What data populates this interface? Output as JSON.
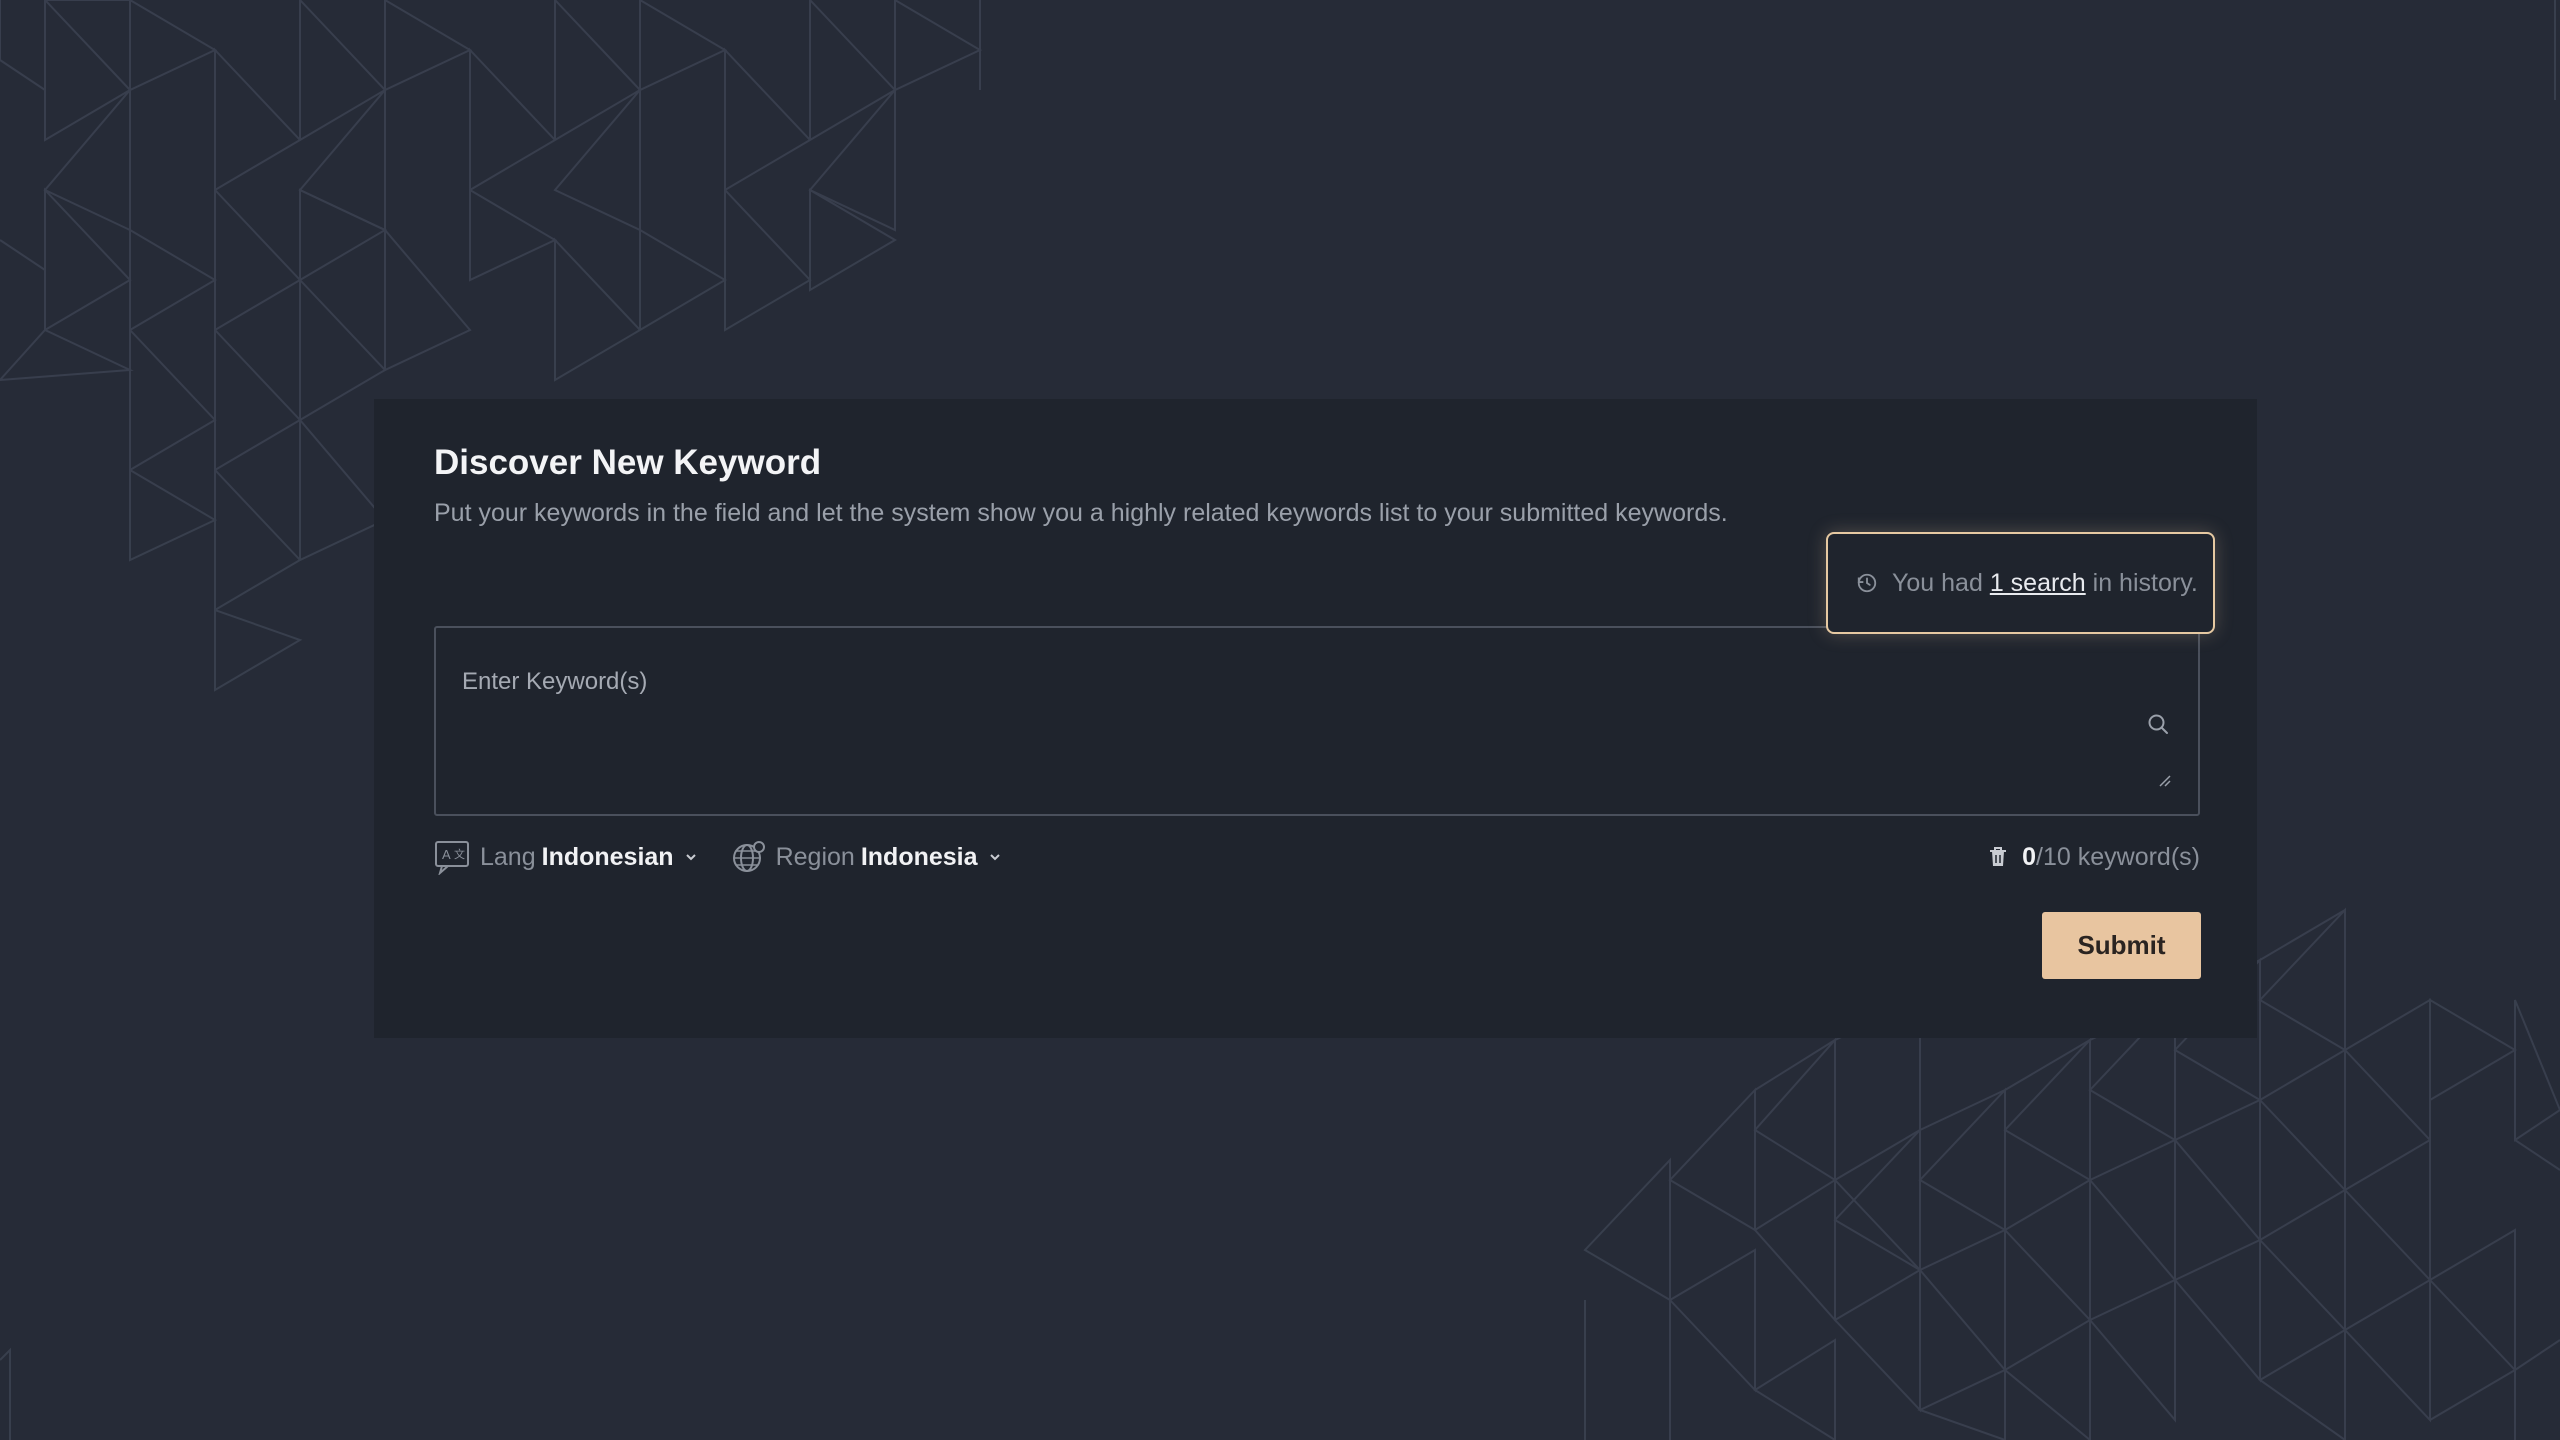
{
  "card": {
    "title": "Discover New Keyword",
    "description": "Put your keywords in the field and let the system show you a highly related keywords list to your submitted keywords."
  },
  "history": {
    "prefix": "You had",
    "link_text": "1 search",
    "suffix": "in history.",
    "border_color": "#e6c9a2"
  },
  "keyword_input": {
    "placeholder": "Enter Keyword(s)",
    "value": ""
  },
  "language": {
    "label": "Lang",
    "value": "Indonesian",
    "icon": "language-icon"
  },
  "region": {
    "label": "Region",
    "value": "Indonesia",
    "icon": "globe-icon"
  },
  "keyword_count": {
    "current": "0",
    "suffix": "/10 keyword(s)",
    "icon": "trash-icon"
  },
  "submit": {
    "label": "Submit",
    "color": "#e8c5a0"
  },
  "colors": {
    "background": "#262b37",
    "card": "#1f242d",
    "text_primary": "#f3f4f6",
    "text_muted": "#9aa0aa"
  }
}
